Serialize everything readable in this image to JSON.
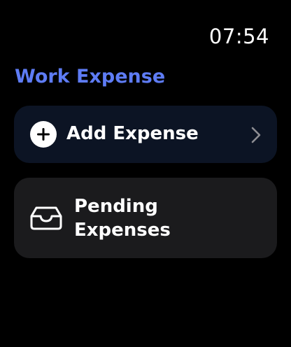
{
  "status_bar": {
    "time": "07:54"
  },
  "app": {
    "title": "Work Expense"
  },
  "menu": {
    "add_expense": {
      "label": "Add Expense",
      "icon": "plus-circle-icon",
      "trailing_icon": "chevron-right-icon"
    },
    "pending_expenses": {
      "label": "Pending Expenses",
      "icon": "inbox-tray-icon"
    }
  },
  "colors": {
    "background": "#000000",
    "title_accent": "#5e7cf5",
    "add_row_bg": "#0c1424",
    "pending_row_bg": "#1b1b1d",
    "text": "#ffffff",
    "chevron": "#8e8e93"
  }
}
